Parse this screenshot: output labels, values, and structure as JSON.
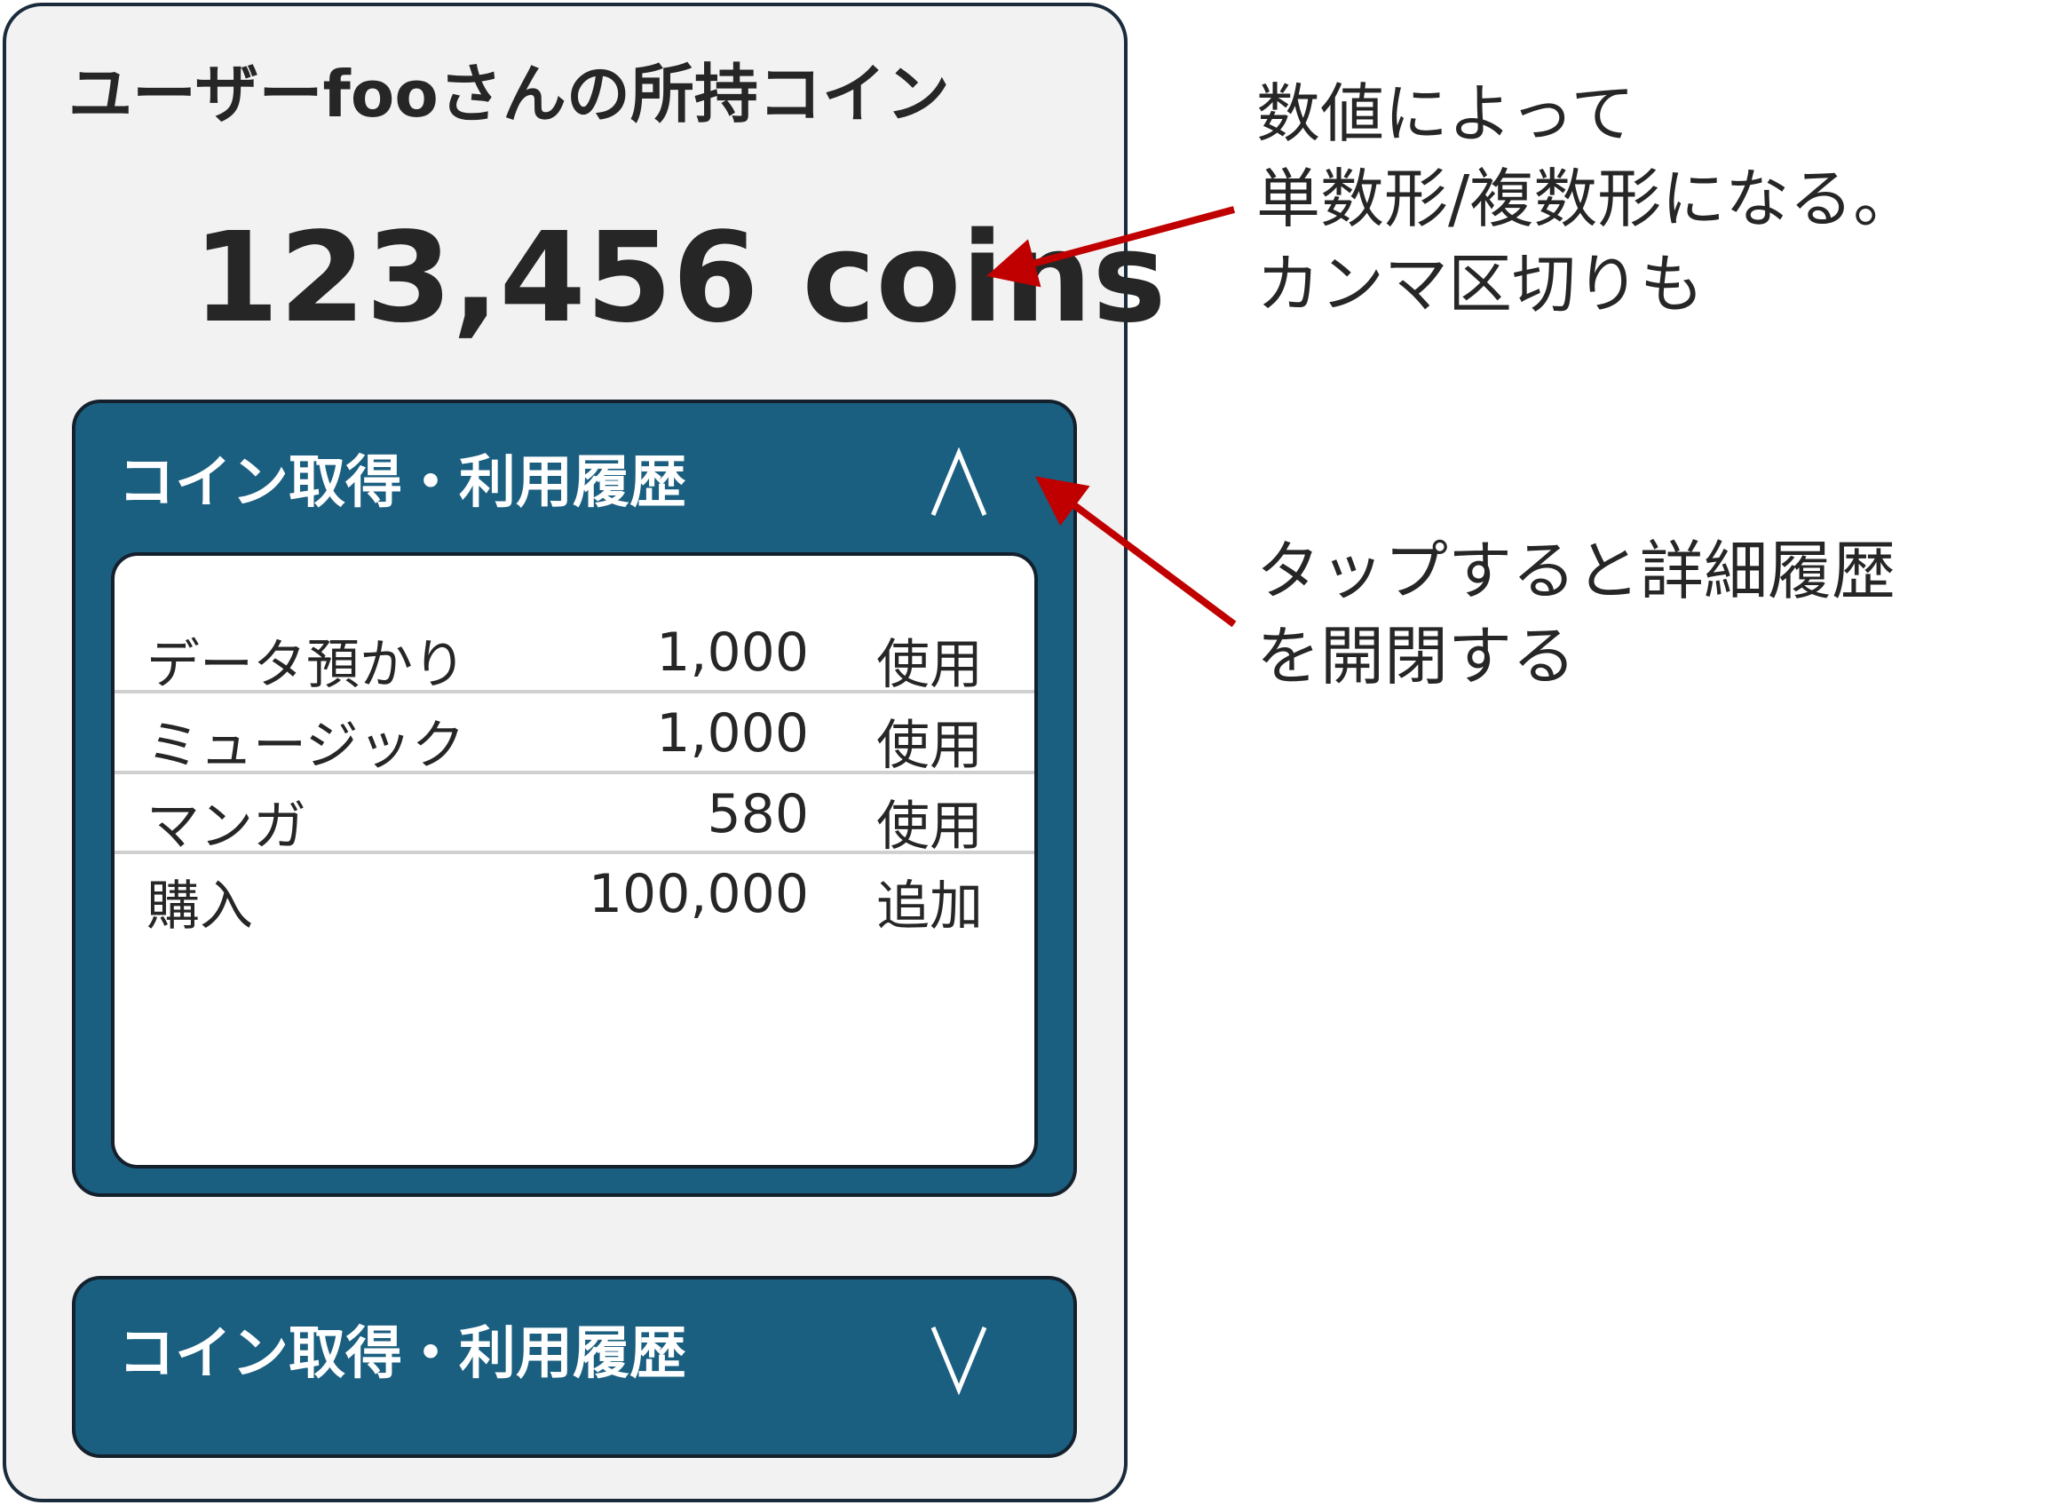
{
  "screen": {
    "title": "ユーザーfooさんの所持コイン",
    "coin_amount": "123,456 coins"
  },
  "history_open": {
    "title": "コイン取得・利用履歴",
    "toggle_symbol": "∧",
    "rows": [
      {
        "name": "データ預かり",
        "amount": "1,000",
        "type": "使用"
      },
      {
        "name": "ミュージック",
        "amount": "1,000",
        "type": "使用"
      },
      {
        "name": "マンガ",
        "amount": "580",
        "type": "使用"
      },
      {
        "name": "購入",
        "amount": "100,000",
        "type": "追加"
      }
    ]
  },
  "history_closed": {
    "title": "コイン取得・利用履歴",
    "toggle_symbol": "∨"
  },
  "annotations": {
    "amount_note": [
      "数値によって",
      "単数形/複数形になる。",
      "カンマ区切りも"
    ],
    "toggle_note": [
      "タップすると詳細履歴",
      "を開閉する"
    ]
  },
  "colors": {
    "panel": "#1a5e80",
    "frame": "#f2f2f2",
    "arrow": "#c00000"
  }
}
